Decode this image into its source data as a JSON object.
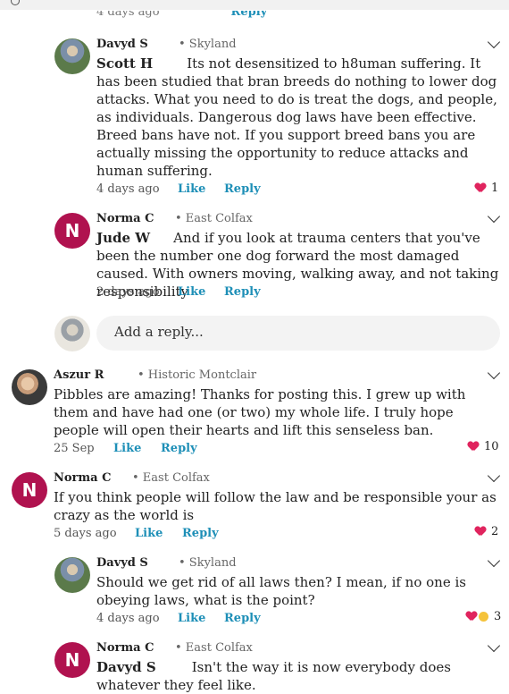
{
  "cutoff": {
    "time": "4 days ago",
    "reply": "Reply"
  },
  "comments": [
    {
      "name": "Davyd S",
      "location": "• Skyland",
      "mention": "Scott H",
      "text": "Its not desensitized to h8uman suffering.  It has been studied that bran breeds do nothing to lower dog attacks.  What you need to do is treat the dogs, and people, as individuals.  Dangerous dog laws have been effective.  Breed bans have not.  If you support breed bans you are actually missing the opportunity to reduce attacks and human suffering.",
      "time": "4 days ago",
      "like": "Like",
      "reply": "Reply",
      "reactions": "1"
    },
    {
      "name": "Norma C",
      "location": "• East Colfax",
      "avatar_letter": "N",
      "mention": "Jude W",
      "text": "And if you look at trauma centers that you've been the number one dog forward the most damaged caused. With owners moving, walking away, and not taking responsibility",
      "time": "2 days ago",
      "like": "Like",
      "reply": "Reply"
    },
    {
      "name": "Aszur R",
      "location": "• Historic Montclair",
      "text": "Pibbles are amazing! Thanks for posting this. I grew up with them and have had one (or two) my whole life. I truly hope people will open their hearts and lift this senseless ban.",
      "time": "25 Sep",
      "like": "Like",
      "reply": "Reply",
      "reactions": "10"
    },
    {
      "name": "Norma C",
      "location": "• East Colfax",
      "avatar_letter": "N",
      "text": "If you think people will follow the law and be responsible your as crazy as the world is",
      "time": "5 days ago",
      "like": "Like",
      "reply": "Reply",
      "reactions": "2"
    },
    {
      "name": "Davyd S",
      "location": "• Skyland",
      "text": "Should we get rid of all laws then?  I mean, if no one is obeying laws, what is the point?",
      "time": "4 days ago",
      "like": "Like",
      "reply": "Reply",
      "reactions": "3"
    },
    {
      "name": "Norma C",
      "location": "• East Colfax",
      "avatar_letter": "N",
      "mention": "Davyd S",
      "text": "Isn't the way it is now everybody does whatever they feel like."
    }
  ],
  "reply_box": {
    "placeholder": "Add a reply..."
  },
  "colors": {
    "link": "#1e8fb7",
    "avatar_n": "#b0124f",
    "heart": "#e0245e"
  }
}
